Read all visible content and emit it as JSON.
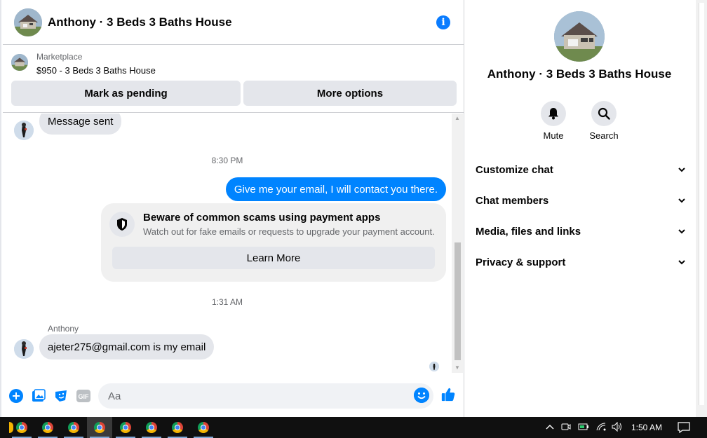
{
  "header": {
    "title": "Anthony · 3 Beds 3 Baths House",
    "info_icon": "info-icon"
  },
  "marketplace": {
    "label": "Marketplace",
    "listing": "$950 - 3 Beds 3 Baths House",
    "mark_pending": "Mark as pending",
    "more_options": "More options"
  },
  "thread": {
    "msg1": "Message sent",
    "time1": "8:30 PM",
    "msg2": "Give me your email, I will contact you there.",
    "scam_title": "Beware of common scams using payment apps",
    "scam_desc": "Watch out for fake emails or requests to upgrade your payment account.",
    "learn_more": "Learn More",
    "time2": "1:31 AM",
    "sender": "Anthony",
    "msg3": "ajeter275@gmail.com is my email"
  },
  "composer": {
    "placeholder": "Aa"
  },
  "sidebar": {
    "name": "Anthony · 3 Beds 3 Baths House",
    "mute": "Mute",
    "search": "Search",
    "sections": [
      "Customize chat",
      "Chat members",
      "Media, files and links",
      "Privacy & support"
    ]
  },
  "taskbar": {
    "time": "1:50 AM"
  },
  "colors": {
    "accent": "#0084ff",
    "bubble_in": "#e4e6eb"
  }
}
